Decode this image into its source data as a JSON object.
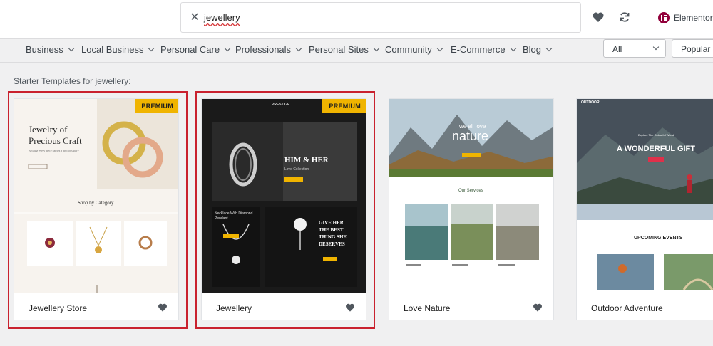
{
  "search": {
    "query": "jewellery"
  },
  "header": {
    "brand_label": "Elementor"
  },
  "categories": [
    {
      "label": "Business"
    },
    {
      "label": "Local Business"
    },
    {
      "label": "Personal Care"
    },
    {
      "label": "Professionals"
    },
    {
      "label": "Personal Sites"
    },
    {
      "label": "Community"
    },
    {
      "label": "E-Commerce"
    },
    {
      "label": "Blog"
    }
  ],
  "filters": {
    "type_value": "All",
    "sort_value": "Popular"
  },
  "section_label": "Starter Templates for jewellery:",
  "colors": {
    "accent_red": "#c9212e",
    "premium_badge": "#f0b400",
    "brand": "#92003b"
  },
  "cards": [
    {
      "title": "Jewellery Store",
      "badge": "PREMIUM",
      "selected": true,
      "preview": {
        "headline_1": "Jewelry of",
        "headline_2": "Precious Craft",
        "tagline": "Because every piece carries a precious story",
        "shop_heading": "Shop by Category"
      }
    },
    {
      "title": "Jewellery",
      "badge": "PREMIUM",
      "selected": true,
      "preview": {
        "brand": "PRESTIGE",
        "hero_1": "HIM & HER",
        "hero_2": "Love Collection",
        "tile_1": "Necklace With Diamond Pendant",
        "tile_2_a": "GIVE HER",
        "tile_2_b": "THE BEST",
        "tile_2_c": "THING SHE",
        "tile_2_d": "DESERVES"
      }
    },
    {
      "title": "Love Nature",
      "badge": "",
      "selected": false,
      "preview": {
        "kicker": "we all love",
        "hero": "nature",
        "services": "Our Services"
      }
    },
    {
      "title": "Outdoor Adventure",
      "badge": "",
      "selected": false,
      "preview": {
        "brand": "OUTDOOR",
        "kicker": "Explore The Colourful World",
        "hero": "A WONDERFUL GIFT",
        "events": "UPCOMING EVENTS"
      }
    }
  ]
}
